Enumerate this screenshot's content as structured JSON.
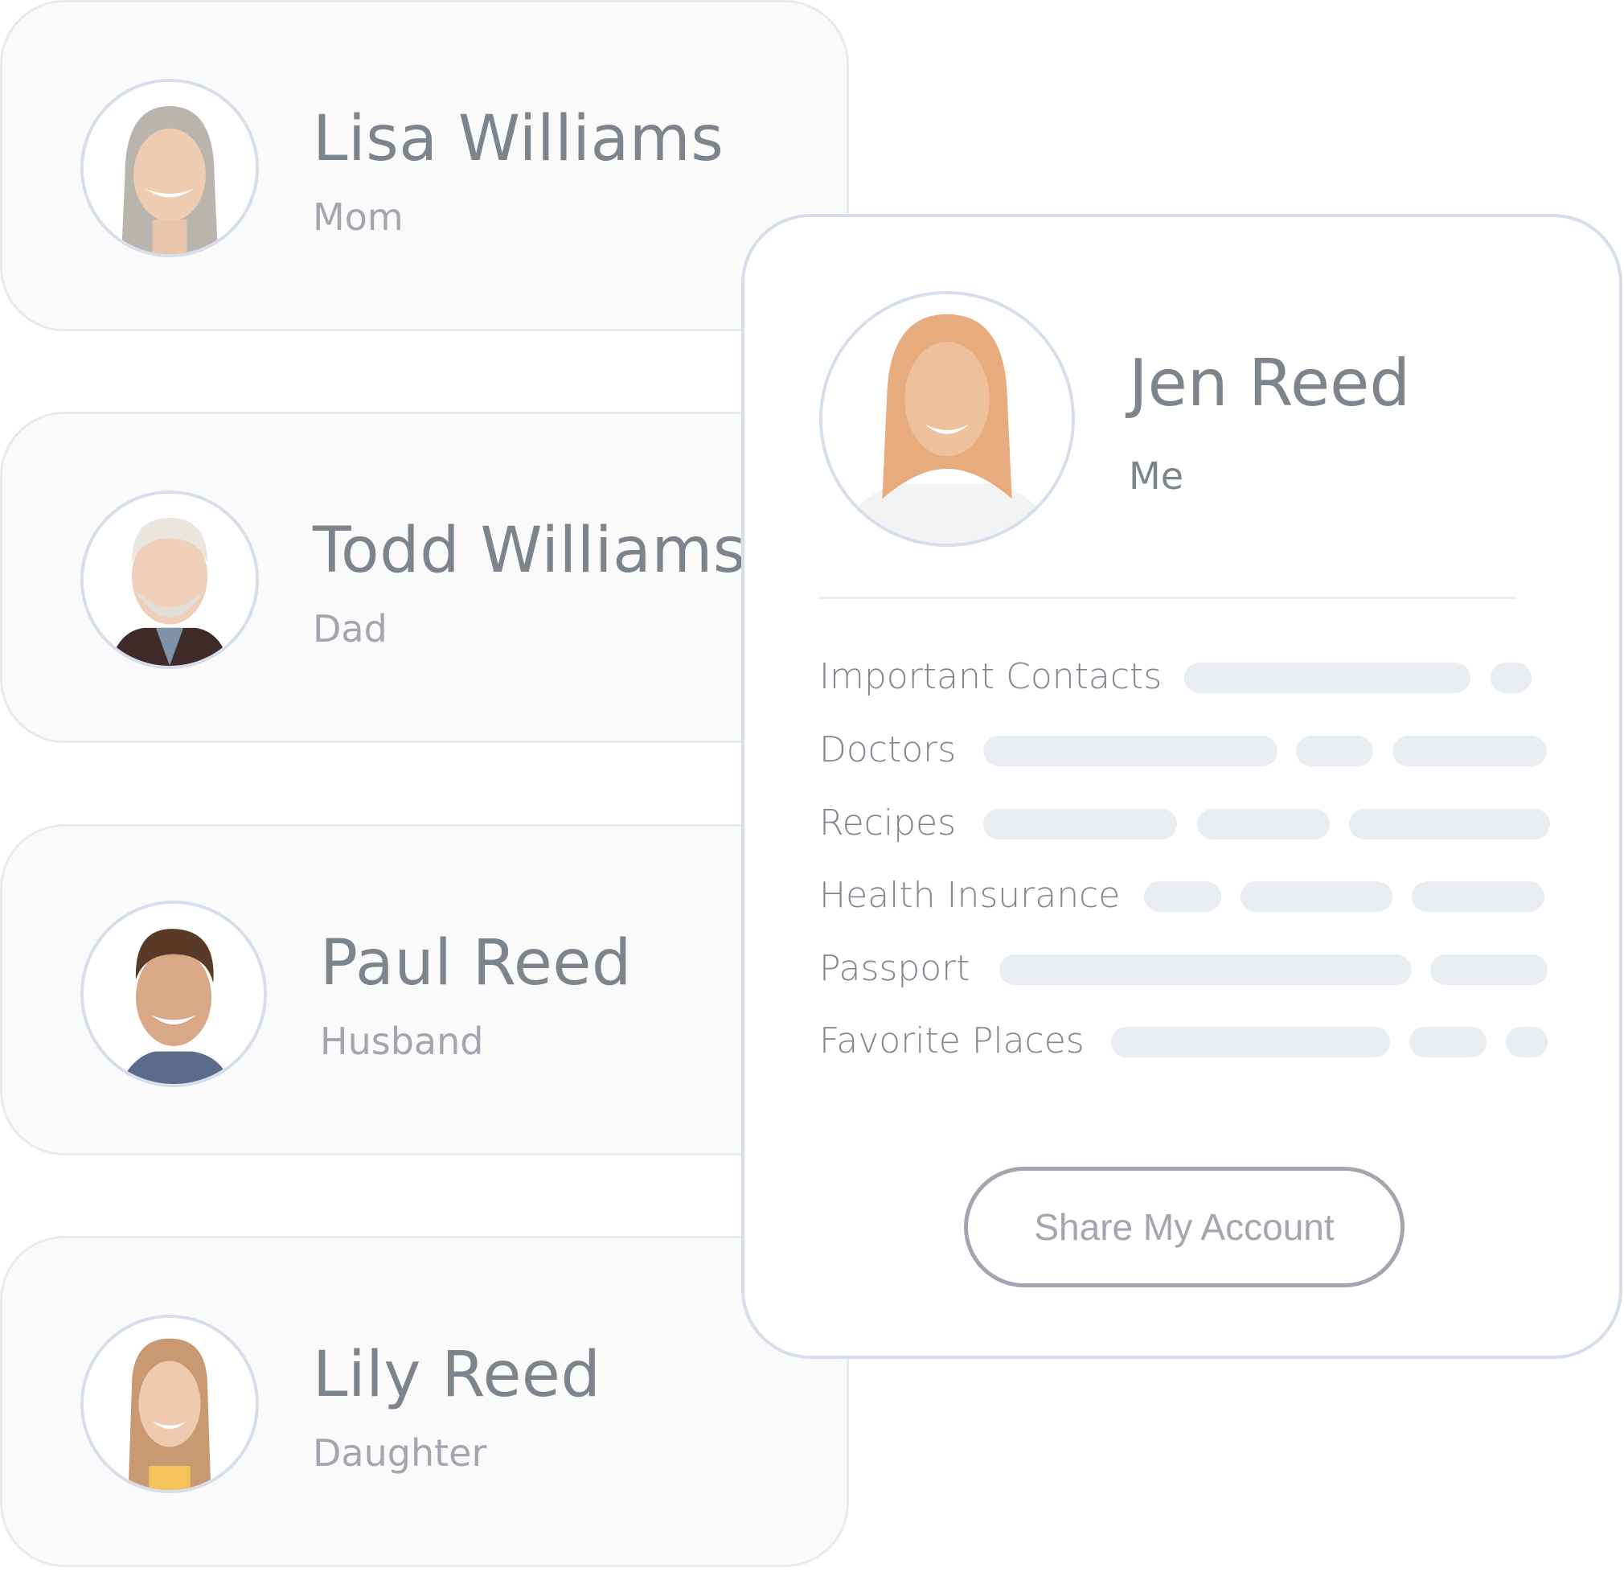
{
  "family_members": [
    {
      "name": "Lisa Williams",
      "relation": "Mom",
      "avatar": "photo-older-woman-gray-hair"
    },
    {
      "name": "Todd Williams",
      "relation": "Dad",
      "avatar": "photo-older-man-white-beard"
    },
    {
      "name": "Paul Reed",
      "relation": "Husband",
      "avatar": "photo-man-brown-hair"
    },
    {
      "name": "Lily Reed",
      "relation": "Daughter",
      "avatar": "photo-young-woman-blonde"
    }
  ],
  "profile": {
    "name": "Jen Reed",
    "relation": "Me",
    "avatar": "photo-woman-strawberry-blonde",
    "documents": [
      {
        "label": "Important Contacts",
        "placeholder_bars": 2
      },
      {
        "label": "Doctors",
        "placeholder_bars": 3
      },
      {
        "label": "Recipes",
        "placeholder_bars": 3
      },
      {
        "label": "Health Insurance",
        "placeholder_bars": 3
      },
      {
        "label": "Passport",
        "placeholder_bars": 2
      },
      {
        "label": "Favorite Places",
        "placeholder_bars": 3
      }
    ],
    "share_button_label": "Share My Account"
  },
  "colors": {
    "text_primary": "#7d848c",
    "text_secondary": "#a4a5af",
    "card_border": "#d5deea",
    "placeholder_bar": "#e9ecf1",
    "card_background": "#fafafb"
  }
}
